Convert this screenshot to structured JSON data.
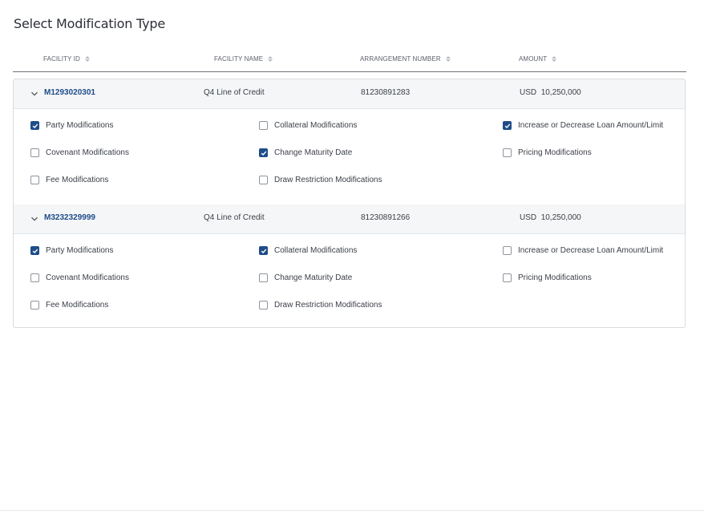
{
  "page": {
    "title": "Select Modification Type"
  },
  "table": {
    "headers": [
      "FACILITY ID",
      "FACILITY NAME",
      "ARRANGEMENT NUMBER",
      "AMOUNT"
    ]
  },
  "facilities": [
    {
      "id": "M1293020301",
      "name": "Q4 Line of Credit",
      "arrangement": "81230891283",
      "currency": "USD",
      "amount": "10,250,000",
      "options": [
        {
          "label": "Party Modifications",
          "checked": true
        },
        {
          "label": "Collateral Modifications",
          "checked": false
        },
        {
          "label": "Increase or Decrease Loan Amount/Limit",
          "checked": true
        },
        {
          "label": "Covenant Modifications",
          "checked": false
        },
        {
          "label": "Change Maturity Date",
          "checked": true
        },
        {
          "label": "Pricing Modifications",
          "checked": false
        },
        {
          "label": "Fee Modifications",
          "checked": false
        },
        {
          "label": "Draw Restriction Modifications",
          "checked": false
        }
      ]
    },
    {
      "id": "M3232329999",
      "name": "Q4 Line of Credit",
      "arrangement": "81230891266",
      "currency": "USD",
      "amount": "10,250,000",
      "options": [
        {
          "label": "Party Modifications",
          "checked": true
        },
        {
          "label": "Collateral Modifications",
          "checked": true
        },
        {
          "label": "Increase or Decrease Loan Amount/Limit",
          "checked": false
        },
        {
          "label": "Covenant Modifications",
          "checked": false
        },
        {
          "label": "Change Maturity Date",
          "checked": false
        },
        {
          "label": "Pricing Modifications",
          "checked": false
        },
        {
          "label": "Fee Modifications",
          "checked": false
        },
        {
          "label": "Draw Restriction Modifications",
          "checked": false
        }
      ]
    }
  ],
  "colors": {
    "accent": "#1f4d8a",
    "header_bg": "#f5f6f7",
    "border": "#d8dbe0"
  }
}
